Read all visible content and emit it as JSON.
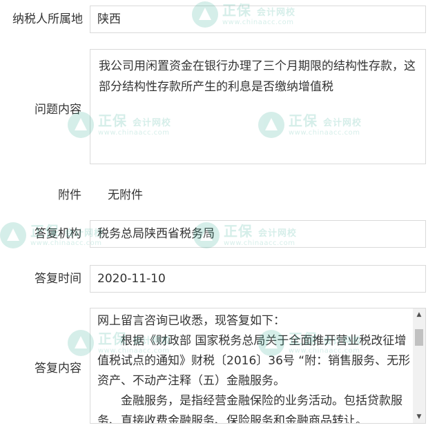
{
  "fields": {
    "region_label": "纳税人所属地",
    "region_value": "陕西",
    "question_label": "问题内容",
    "question_text": "我公司用闲置资金在银行办理了三个月期限的结构性存款，这部分结构性存款所产生的利息是否缴纳增值税",
    "attachment_label": "附件",
    "attachment_value": "无附件",
    "agency_label": "答复机构",
    "agency_value": "税务总局陕西省税务局",
    "reply_time_label": "答复时间",
    "reply_time_value": "2020-11-10",
    "reply_content_label": "答复内容",
    "reply_paragraphs": [
      "网上留言咨询已收悉，现答复如下：",
      "　　根据《财政部 国家税务总局关于全面推开营业税改征增值税试点的通知》财税〔2016〕36号 “附：销售服务、无形资产、不动产注释（五）金融服务。",
      "　　金融服务，是指经营金融保险的业务活动。包括贷款服务、直接收费金融服务、保险服务和金融商品转让。"
    ]
  },
  "watermark": {
    "brand": "正保",
    "sub": "会计网校",
    "url": "www.chinaacc.com",
    "color": "#1fa38a"
  },
  "icons": {
    "scroll_up": "scroll-up-arrow-icon",
    "scroll_down": "scroll-down-arrow-icon",
    "watermark_logo": "chinaacc-logo-icon"
  }
}
